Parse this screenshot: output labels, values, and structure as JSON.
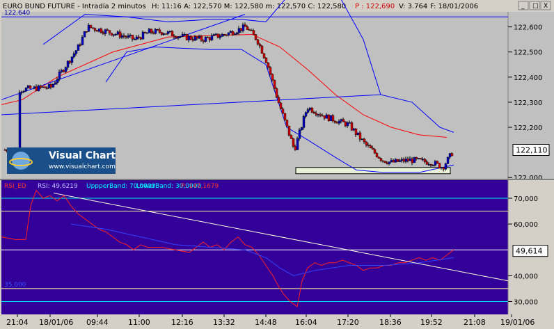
{
  "window": {
    "title": "EURO BUND FUTURE - Intradía 2 minutos",
    "ohlc_text": "H: 11:16  A: 122,570  M: 122,580  m: 122,570  C: 122,580",
    "p_label": "P : 122,690",
    "volume_text": "V: 3.764",
    "date_text": "F: 18/01/2006",
    "buttons": [
      "_",
      "□",
      "X"
    ]
  },
  "logo": {
    "name": "Visual Chart",
    "url": "www.visualchart.com"
  },
  "price_panel": {
    "left_level_label": "122.640",
    "current_value": "122,110",
    "y_ticks": [
      "122,600",
      "122,500",
      "122,400",
      "122,300",
      "122,200",
      "122,000"
    ]
  },
  "rsi_panel": {
    "legend": [
      {
        "text": "RSI_ED",
        "color": "#ff3333"
      },
      {
        "text": "RSI: 49,6219",
        "color": "#c0c0ff"
      },
      {
        "text": "UppperBand: 70,0000",
        "color": "#00ffff"
      },
      {
        "text": "LowerBand: 30,0000",
        "color": "#00ffff"
      },
      {
        "text": "P: 147,1679",
        "color": "#ff3333"
      }
    ],
    "current_value": "49,614",
    "left_level_label": "35,000",
    "y_ticks": [
      "70,000",
      "60,000",
      "40,000",
      "30,000"
    ]
  },
  "time_axis": [
    "21:04",
    "18/01/06",
    "09:44",
    "11:00",
    "12:16",
    "13:32",
    "14:48",
    "16:04",
    "17:20",
    "18:36",
    "19:52",
    "21:08",
    "19/01/06"
  ],
  "colors": {
    "price_bg": "#c0c0c0",
    "rsi_bg": "#330099",
    "candle_up": "#0000c0",
    "candle_down": "#cc0000",
    "bands": "#0000ff",
    "moving_average": "#ff0000",
    "rsi_line": "#ff2020",
    "rsi_average": "#3344ff",
    "trendline": "#ffffdd",
    "guide_cyan": "#00e8e8",
    "guide_yellow": "#ffff99"
  },
  "chart_data": [
    {
      "type": "candlestick",
      "title": "EURO BUND FUTURE - Intradía 2 minutos",
      "ylim": [
        121.995,
        122.66
      ],
      "horizontal_level": 122.64,
      "support_box": {
        "from": "16:04",
        "to": "21:08",
        "low": 122.015,
        "high": 122.04
      },
      "close_path": [
        [
          "21:04",
          122.35
        ],
        [
          "18/01/06",
          122.36
        ],
        [
          "09:00",
          122.52
        ],
        [
          "09:20",
          122.6
        ],
        [
          "09:44",
          122.59
        ],
        [
          "10:20",
          122.57
        ],
        [
          "10:50",
          122.55
        ],
        [
          "11:16",
          122.58
        ],
        [
          "11:40",
          122.58
        ],
        [
          "12:16",
          122.56
        ],
        [
          "12:50",
          122.55
        ],
        [
          "13:32",
          122.57
        ],
        [
          "14:10",
          122.6
        ],
        [
          "14:30",
          122.55
        ],
        [
          "14:48",
          122.46
        ],
        [
          "15:10",
          122.3
        ],
        [
          "15:40",
          122.11
        ],
        [
          "16:04",
          122.28
        ],
        [
          "16:40",
          122.24
        ],
        [
          "17:20",
          122.21
        ],
        [
          "17:50",
          122.13
        ],
        [
          "18:20",
          122.07
        ],
        [
          "18:36",
          122.06
        ],
        [
          "19:10",
          122.07
        ],
        [
          "19:52",
          122.06
        ],
        [
          "20:10",
          122.04
        ],
        [
          "20:30",
          122.11
        ]
      ],
      "series": [
        {
          "name": "Moving average",
          "color": "#ff0000",
          "points": [
            [
              0,
              122.29
            ],
            [
              30,
              122.31
            ],
            [
              80,
              122.4
            ],
            [
              160,
              122.5
            ],
            [
              240,
              122.56
            ],
            [
              360,
              122.57
            ],
            [
              400,
              122.52
            ],
            [
              440,
              122.43
            ],
            [
              480,
              122.33
            ],
            [
              520,
              122.25
            ],
            [
              560,
              122.2
            ],
            [
              600,
              122.17
            ],
            [
              640,
              122.16
            ]
          ]
        },
        {
          "name": "Upper band",
          "color": "#0000ff",
          "points": [
            [
              60,
              122.53
            ],
            [
              120,
              122.65
            ],
            [
              180,
              122.64
            ],
            [
              240,
              122.62
            ],
            [
              300,
              122.63
            ],
            [
              345,
              122.63
            ],
            [
              380,
              122.62
            ],
            [
              420,
              122.75
            ],
            [
              480,
              122.75
            ],
            [
              520,
              122.55
            ],
            [
              545,
              122.33
            ],
            [
              590,
              122.3
            ],
            [
              630,
              122.2
            ],
            [
              650,
              122.18
            ]
          ]
        },
        {
          "name": "Lower band",
          "color": "#0000ff",
          "points": [
            [
              150,
              122.38
            ],
            [
              180,
              122.5
            ],
            [
              220,
              122.52
            ],
            [
              300,
              122.51
            ],
            [
              345,
              122.51
            ],
            [
              380,
              122.45
            ],
            [
              410,
              122.2
            ],
            [
              440,
              122.15
            ],
            [
              480,
              122.08
            ],
            [
              510,
              122.03
            ],
            [
              550,
              122.02
            ],
            [
              600,
              122.02
            ],
            [
              650,
              122.05
            ]
          ]
        },
        {
          "name": "Trend channel",
          "color": "#0000ff",
          "points": [
            [
              0,
              122.25
            ],
            [
              545,
              122.33
            ]
          ]
        },
        {
          "name": "Trend channel 2",
          "color": "#0000ff",
          "points": [
            [
              0,
              122.31
            ],
            [
              350,
              122.65
            ]
          ]
        }
      ]
    },
    {
      "type": "line",
      "title": "RSI_ED",
      "ylim": [
        25,
        77
      ],
      "bands": {
        "upper": 70,
        "lower": 30,
        "mid_upper": 65,
        "mid": 50,
        "mid_lower": 35
      },
      "series": [
        {
          "name": "RSI",
          "color": "#ff2020",
          "points": [
            [
              0,
              55
            ],
            [
              20,
              54
            ],
            [
              35,
              54
            ],
            [
              42,
              67
            ],
            [
              50,
              73
            ],
            [
              60,
              70
            ],
            [
              70,
              71
            ],
            [
              80,
              69
            ],
            [
              90,
              71
            ],
            [
              100,
              67
            ],
            [
              110,
              64
            ],
            [
              120,
              62
            ],
            [
              130,
              60
            ],
            [
              140,
              58
            ],
            [
              150,
              57
            ],
            [
              160,
              55
            ],
            [
              170,
              53
            ],
            [
              180,
              52
            ],
            [
              190,
              50
            ],
            [
              200,
              52
            ],
            [
              210,
              51
            ],
            [
              230,
              51
            ],
            [
              250,
              50
            ],
            [
              270,
              49
            ],
            [
              280,
              51
            ],
            [
              290,
              53
            ],
            [
              300,
              51
            ],
            [
              310,
              52
            ],
            [
              320,
              50
            ],
            [
              330,
              53
            ],
            [
              340,
              55
            ],
            [
              350,
              52
            ],
            [
              360,
              51
            ],
            [
              370,
              48
            ],
            [
              380,
              44
            ],
            [
              390,
              40
            ],
            [
              398,
              36
            ],
            [
              405,
              33
            ],
            [
              415,
              30
            ],
            [
              425,
              28
            ],
            [
              432,
              38
            ],
            [
              440,
              43
            ],
            [
              450,
              45
            ],
            [
              460,
              44
            ],
            [
              470,
              45
            ],
            [
              480,
              45
            ],
            [
              490,
              46
            ],
            [
              500,
              45
            ],
            [
              510,
              44
            ],
            [
              520,
              42
            ],
            [
              530,
              43
            ],
            [
              540,
              43
            ],
            [
              550,
              44
            ],
            [
              560,
              44
            ],
            [
              570,
              45
            ],
            [
              580,
              45
            ],
            [
              590,
              46
            ],
            [
              600,
              47
            ],
            [
              610,
              46
            ],
            [
              620,
              47
            ],
            [
              630,
              46
            ],
            [
              640,
              48
            ],
            [
              650,
              50
            ]
          ]
        },
        {
          "name": "RSI average",
          "color": "#3344ff",
          "points": [
            [
              100,
              60
            ],
            [
              150,
              58
            ],
            [
              200,
              55
            ],
            [
              250,
              52
            ],
            [
              300,
              51
            ],
            [
              350,
              50
            ],
            [
              380,
              47
            ],
            [
              400,
              43
            ],
            [
              420,
              40
            ],
            [
              450,
              42
            ],
            [
              500,
              44
            ],
            [
              550,
              44
            ],
            [
              600,
              45
            ],
            [
              650,
              47
            ]
          ]
        },
        {
          "name": "Trendline",
          "color": "#ffffdd",
          "points": [
            [
              75,
              72
            ],
            [
              728,
              38
            ]
          ]
        }
      ]
    }
  ]
}
